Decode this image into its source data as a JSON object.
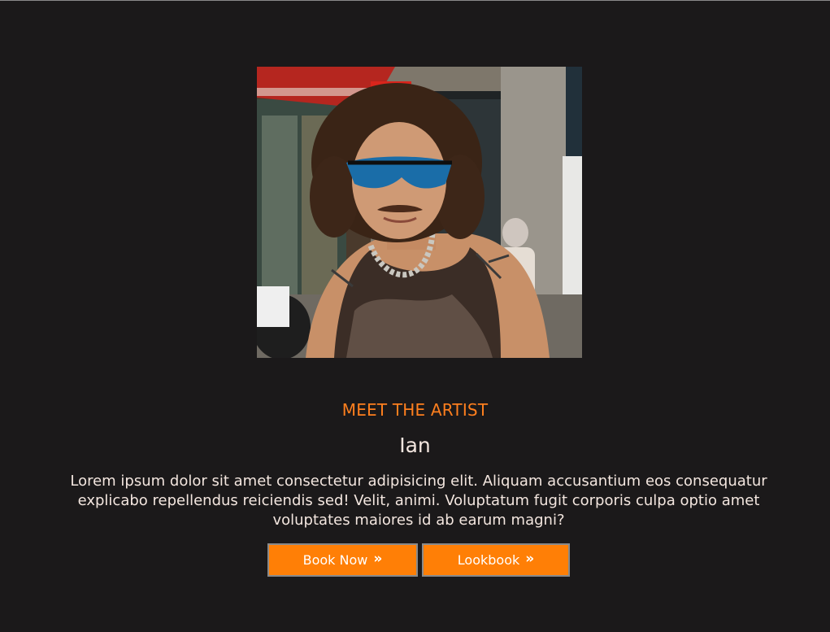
{
  "hero": {
    "image_alt": "Portrait of the artist wearing reflective sunglasses on a city street"
  },
  "intro": {
    "eyebrow": "MEET THE ARTIST",
    "name": "Ian",
    "bio": "Lorem ipsum dolor sit amet consectetur adipisicing elit. Aliquam accusantium eos consequatur explicabo repellendus reiciendis sed! Velit, animi. Voluptatum fugit corporis culpa optio amet voluptates maiores id ab earum magni?"
  },
  "actions": {
    "book_label": "Book Now",
    "lookbook_label": "Lookbook",
    "chevron_icon": "double-chevron-right-icon"
  },
  "colors": {
    "background": "#1b191a",
    "accent": "#ff7f1e",
    "button": "#ff7f06",
    "text": "#f3e6df"
  }
}
